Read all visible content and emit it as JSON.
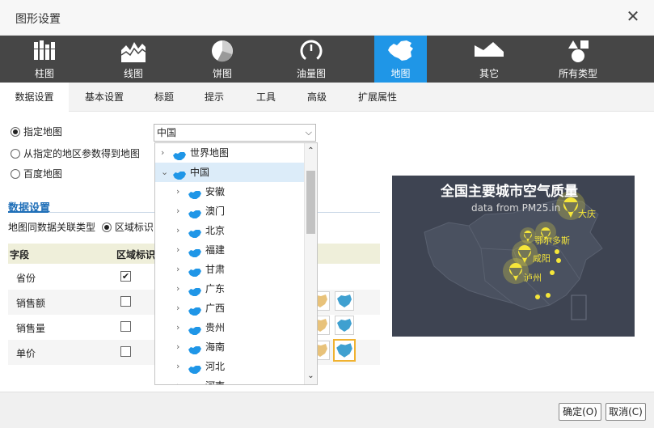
{
  "dialog": {
    "title": "图形设置"
  },
  "chart_types": [
    {
      "label": "柱图",
      "icon": "bar-chart-icon"
    },
    {
      "label": "线图",
      "icon": "line-chart-icon"
    },
    {
      "label": "饼图",
      "icon": "pie-chart-icon"
    },
    {
      "label": "油量图",
      "icon": "gauge-icon"
    },
    {
      "label": "地图",
      "icon": "china-map-icon",
      "active": true
    },
    {
      "label": "其它",
      "icon": "area-shape-icon"
    },
    {
      "label": "所有类型",
      "icon": "shapes-icon"
    }
  ],
  "tabs": [
    "数据设置",
    "基本设置",
    "标题",
    "提示",
    "工具",
    "高级",
    "扩展属性"
  ],
  "map_source": {
    "options": [
      "指定地图",
      "从指定的地区参数得到地图",
      "百度地图"
    ],
    "selected": "指定地图",
    "select_value": "中国"
  },
  "tree": {
    "nodes": [
      {
        "label": "世界地图",
        "level": 0,
        "expander": "›"
      },
      {
        "label": "中国",
        "level": 0,
        "expander": "⌄",
        "selected": true
      },
      {
        "label": "安徽",
        "level": 1,
        "expander": "›"
      },
      {
        "label": "澳门",
        "level": 1,
        "expander": "›"
      },
      {
        "label": "北京",
        "level": 1,
        "expander": "›"
      },
      {
        "label": "福建",
        "level": 1,
        "expander": "›"
      },
      {
        "label": "甘肃",
        "level": 1,
        "expander": "›"
      },
      {
        "label": "广东",
        "level": 1,
        "expander": "›"
      },
      {
        "label": "广西",
        "level": 1,
        "expander": "›"
      },
      {
        "label": "贵州",
        "level": 1,
        "expander": "›"
      },
      {
        "label": "海南",
        "level": 1,
        "expander": "›"
      },
      {
        "label": "河北",
        "level": 1,
        "expander": "›"
      },
      {
        "label": "河南",
        "level": 1,
        "expander": "›"
      }
    ]
  },
  "data_settings": {
    "section_title": "数据设置",
    "assoc_label": "地图同数据关联类型",
    "assoc_option": "区域标识",
    "columns": [
      "字段",
      "区域标识"
    ],
    "rows": [
      {
        "name": "省份",
        "checked": true
      },
      {
        "name": "销售额",
        "checked": false
      },
      {
        "name": "销售量",
        "checked": false
      },
      {
        "name": "单价",
        "checked": false
      }
    ]
  },
  "preview": {
    "title": "全国主要城市空气质量",
    "subtitle": "data from PM25.in",
    "cities": [
      "大庆",
      "鄂尔多斯",
      "咸阳",
      "泸州"
    ],
    "accent": "#f5e63a",
    "background": "#3e4452"
  },
  "buttons": {
    "ok": "确定(O)",
    "cancel": "取消(C)"
  },
  "colors": {
    "active_type": "#1f96e7",
    "typebar": "#464646",
    "map_icon": "#1f96e7"
  }
}
